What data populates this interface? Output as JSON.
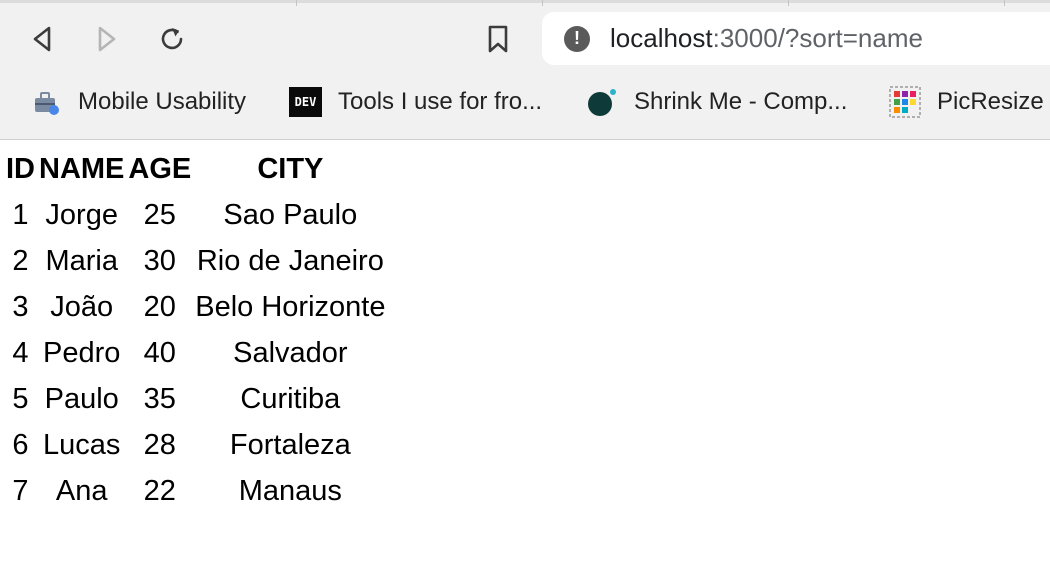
{
  "browser": {
    "url_host": "localhost",
    "url_rest": ":3000/?sort=name",
    "bookmarks": [
      {
        "label": "Mobile Usability",
        "icon": "toolbox-icon"
      },
      {
        "label": "Tools I use for fro...",
        "icon": "dev-icon"
      },
      {
        "label": "Shrink Me - Comp...",
        "icon": "shrinkme-icon"
      },
      {
        "label": "PicResize",
        "icon": "picresize-icon"
      }
    ]
  },
  "table": {
    "headers": [
      "ID",
      "NAME",
      "AGE",
      "CITY"
    ],
    "rows": [
      [
        "1",
        "Jorge",
        "25",
        "Sao Paulo"
      ],
      [
        "2",
        "Maria",
        "30",
        "Rio de Janeiro"
      ],
      [
        "3",
        "João",
        "20",
        "Belo Horizonte"
      ],
      [
        "4",
        "Pedro",
        "40",
        "Salvador"
      ],
      [
        "5",
        "Paulo",
        "35",
        "Curitiba"
      ],
      [
        "6",
        "Lucas",
        "28",
        "Fortaleza"
      ],
      [
        "7",
        "Ana",
        "22",
        "Manaus"
      ]
    ]
  }
}
